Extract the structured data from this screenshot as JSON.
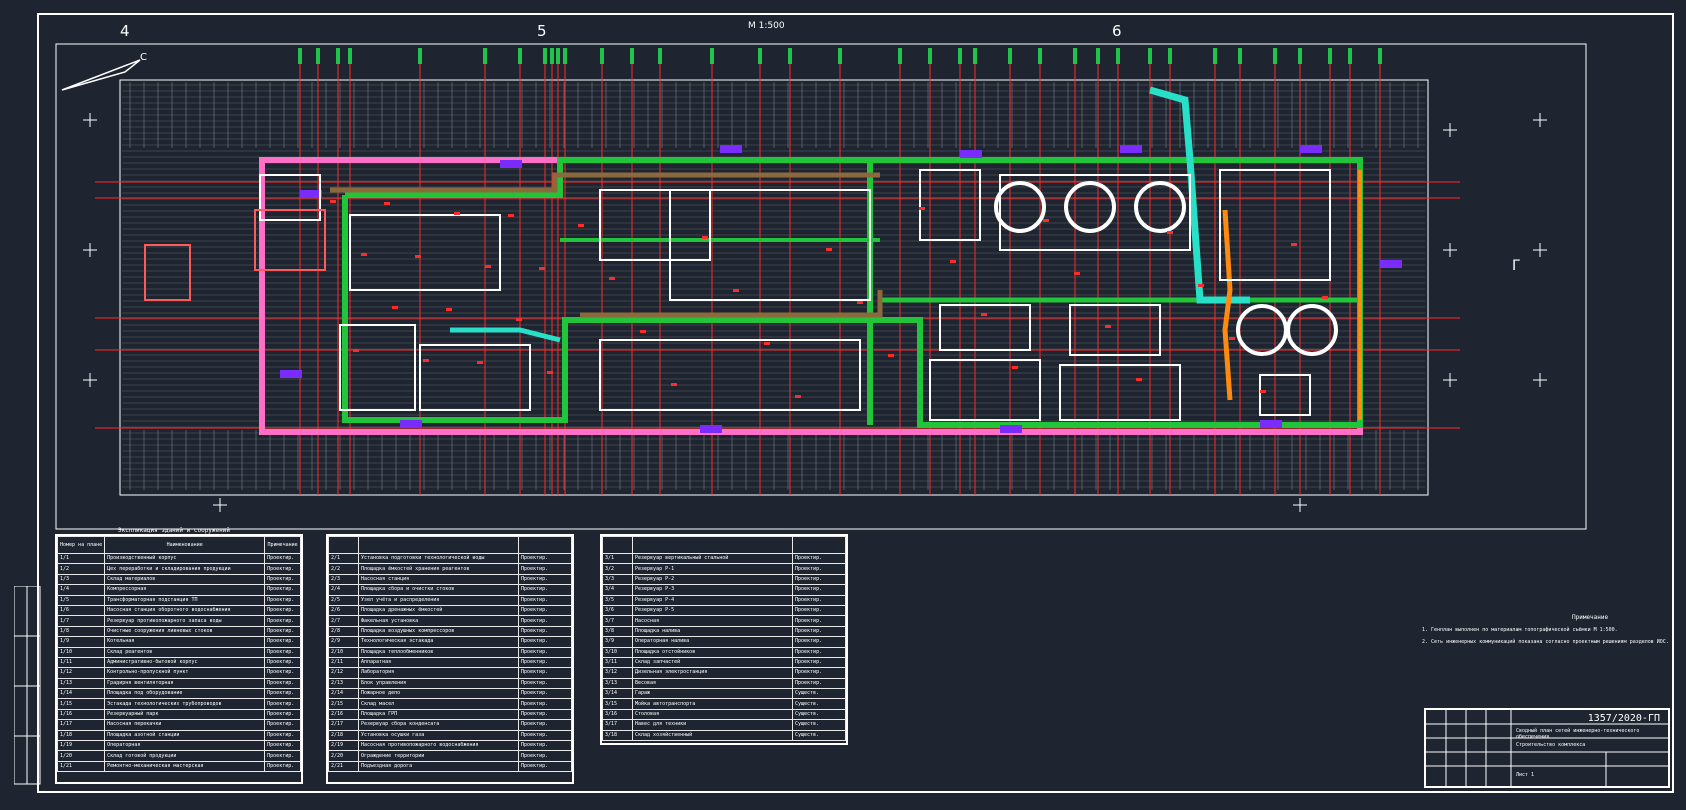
{
  "drawing": {
    "scale_label": "М 1:500",
    "column_numbers": [
      "4",
      "5",
      "6"
    ],
    "north_label": "С",
    "section_label": "Г"
  },
  "tables": {
    "left": {
      "title": "Экспликация зданий и сооружений",
      "headers": [
        "Номер на плане",
        "Наименование",
        "Примечание"
      ],
      "rows": [
        [
          "1/1",
          "Производственный корпус",
          "Проектир."
        ],
        [
          "1/2",
          "Цех переработки и складирования продукции",
          "Проектир."
        ],
        [
          "1/3",
          "Склад материалов",
          "Проектир."
        ],
        [
          "1/4",
          "Компрессорная",
          "Проектир."
        ],
        [
          "1/5",
          "Трансформаторная подстанция ТП",
          "Проектир."
        ],
        [
          "1/6",
          "Насосная станция оборотного водоснабжения",
          "Проектир."
        ],
        [
          "1/7",
          "Резервуар противопожарного запаса воды",
          "Проектир."
        ],
        [
          "1/8",
          "Очистные сооружения ливневых стоков",
          "Проектир."
        ],
        [
          "1/9",
          "Котельная",
          "Проектир."
        ],
        [
          "1/10",
          "Склад реагентов",
          "Проектир."
        ],
        [
          "1/11",
          "Административно-бытовой корпус",
          "Проектир."
        ],
        [
          "1/12",
          "Контрольно-пропускной пункт",
          "Проектир."
        ],
        [
          "1/13",
          "Градирня вентиляторная",
          "Проектир."
        ],
        [
          "1/14",
          "Площадка под оборудование",
          "Проектир."
        ],
        [
          "1/15",
          "Эстакада технологических трубопроводов",
          "Проектир."
        ],
        [
          "1/16",
          "Резервуарный парк",
          "Проектир."
        ],
        [
          "1/17",
          "Насосная перекачки",
          "Проектир."
        ],
        [
          "1/18",
          "Площадка азотной станции",
          "Проектир."
        ],
        [
          "1/19",
          "Операторная",
          "Проектир."
        ],
        [
          "1/20",
          "Склад готовой продукции",
          "Проектир."
        ],
        [
          "1/21",
          "Ремонтно-механическая мастерская",
          "Проектир."
        ]
      ]
    },
    "middle": {
      "title": "",
      "headers": [
        "",
        "",
        ""
      ],
      "rows": [
        [
          "2/1",
          "Установка подготовки технологической воды",
          "Проектир."
        ],
        [
          "2/2",
          "Площадка ёмкостей хранения реагентов",
          "Проектир."
        ],
        [
          "2/3",
          "Насосная станция",
          "Проектир."
        ],
        [
          "2/4",
          "Площадка сбора и очистки стоков",
          "Проектир."
        ],
        [
          "2/5",
          "Узел учёта и распределения",
          "Проектир."
        ],
        [
          "2/6",
          "Площадка дренажных ёмкостей",
          "Проектир."
        ],
        [
          "2/7",
          "Факельная установка",
          "Проектир."
        ],
        [
          "2/8",
          "Площадка воздушных компрессоров",
          "Проектир."
        ],
        [
          "2/9",
          "Технологическая эстакада",
          "Проектир."
        ],
        [
          "2/10",
          "Площадка теплообменников",
          "Проектир."
        ],
        [
          "2/11",
          "Аппаратная",
          "Проектир."
        ],
        [
          "2/12",
          "Лаборатория",
          "Проектир."
        ],
        [
          "2/13",
          "Блок управления",
          "Проектир."
        ],
        [
          "2/14",
          "Пожарное депо",
          "Проектир."
        ],
        [
          "2/15",
          "Склад масел",
          "Проектир."
        ],
        [
          "2/16",
          "Площадка ГРП",
          "Проектир."
        ],
        [
          "2/17",
          "Резервуар сбора конденсата",
          "Проектир."
        ],
        [
          "2/18",
          "Установка осушки газа",
          "Проектир."
        ],
        [
          "2/19",
          "Насосная противопожарного водоснабжения",
          "Проектир."
        ],
        [
          "2/20",
          "Ограждение территории",
          "Проектир."
        ],
        [
          "2/21",
          "Подъездная дорога",
          "Проектир."
        ]
      ]
    },
    "right": {
      "title": "",
      "headers": [
        "",
        "",
        ""
      ],
      "rows": [
        [
          "3/1",
          "Резервуар вертикальный стальной",
          "Проектир."
        ],
        [
          "3/2",
          "Резервуар Р-1",
          "Проектир."
        ],
        [
          "3/3",
          "Резервуар Р-2",
          "Проектир."
        ],
        [
          "3/4",
          "Резервуар Р-3",
          "Проектир."
        ],
        [
          "3/5",
          "Резервуар Р-4",
          "Проектир."
        ],
        [
          "3/6",
          "Резервуар Р-5",
          "Проектир."
        ],
        [
          "3/7",
          "Насосная",
          "Проектир."
        ],
        [
          "3/8",
          "Площадка налива",
          "Проектир."
        ],
        [
          "3/9",
          "Операторная налива",
          "Проектир."
        ],
        [
          "3/10",
          "Площадка отстойников",
          "Проектир."
        ],
        [
          "3/11",
          "Склад запчастей",
          "Проектир."
        ],
        [
          "3/12",
          "Дизельная электростанция",
          "Проектир."
        ],
        [
          "3/13",
          "Весовая",
          "Проектир."
        ],
        [
          "3/14",
          "Гараж",
          "Существ."
        ],
        [
          "3/15",
          "Мойка автотранспорта",
          "Существ."
        ],
        [
          "3/16",
          "Столовая",
          "Существ."
        ],
        [
          "3/17",
          "Навес для техники",
          "Существ."
        ],
        [
          "3/18",
          "Склад хозяйственный",
          "Существ."
        ]
      ]
    }
  },
  "notes": {
    "title": "Примечание",
    "lines": [
      "1. Генплан выполнен по материалам топографической съёмки М 1:500.",
      "2. Сеть инженерных коммуникаций показана согласно проектным решениям разделов ИОС."
    ]
  },
  "stamp": {
    "code": "1357/2020-ГП",
    "line1": "Сводный план сетей инженерно-технического обеспечения",
    "line2": "Строительство комплекса",
    "line3": "Лист 1"
  }
}
